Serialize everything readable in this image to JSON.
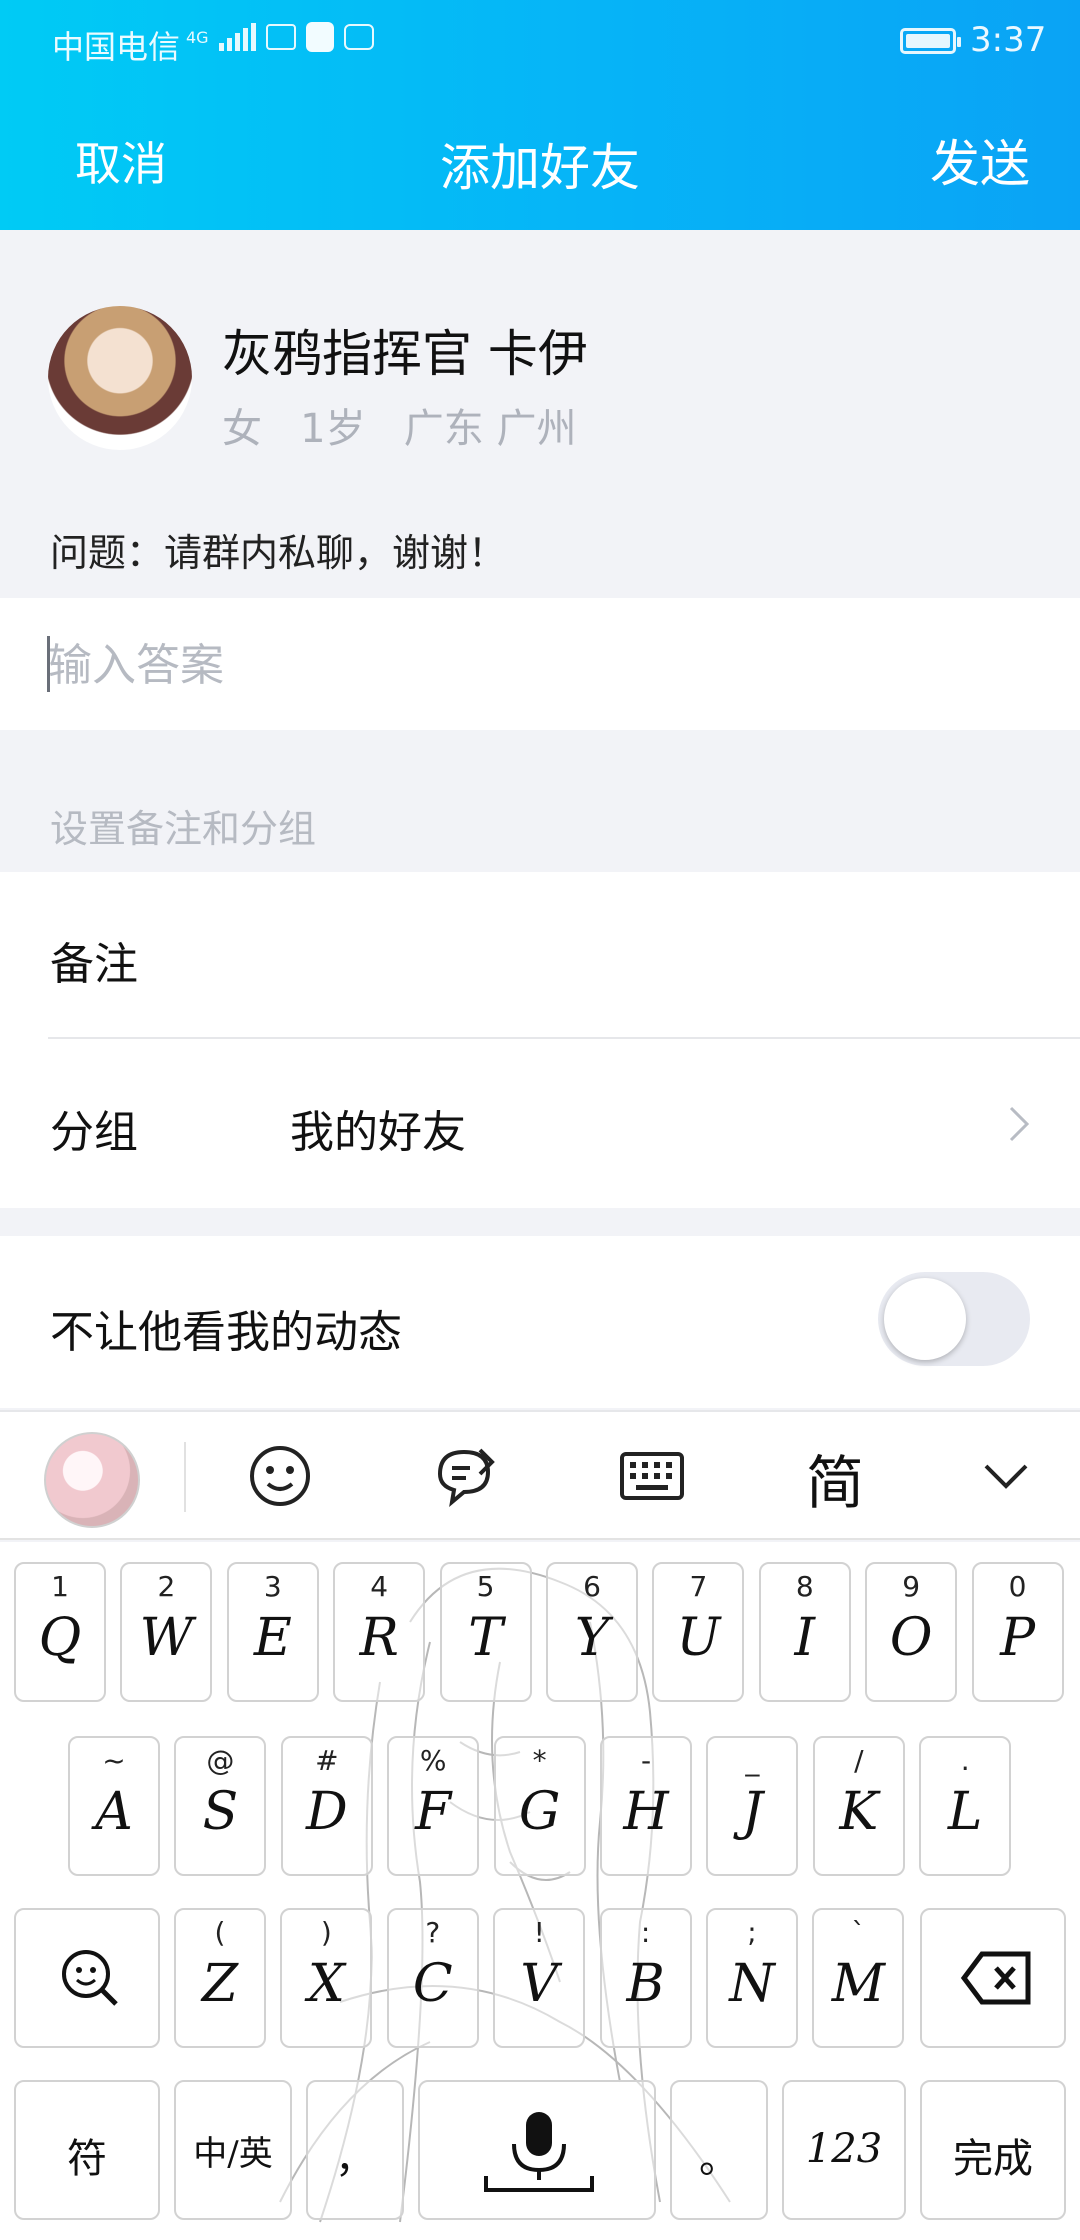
{
  "status": {
    "carrier": "中国电信",
    "network": "4G",
    "time": "3:37"
  },
  "nav": {
    "cancel": "取消",
    "title": "添加好友",
    "send": "发送"
  },
  "profile": {
    "name": "灰鸦指挥官  卡伊",
    "gender": "女",
    "age": "1岁",
    "location": "广东 广州",
    "question": "问题：请群内私聊，谢谢！"
  },
  "answer": {
    "placeholder": "输入答案",
    "value": ""
  },
  "settings": {
    "section_title": "设置备注和分组",
    "remark_label": "备注",
    "group_label": "分组",
    "group_value": "我的好友",
    "privacy_label": "不让他看我的动态",
    "privacy_enabled": false
  },
  "keyboard": {
    "toolbar": {
      "simplified": "简"
    },
    "row1": [
      {
        "sub": "1",
        "main": "Q"
      },
      {
        "sub": "2",
        "main": "W"
      },
      {
        "sub": "3",
        "main": "E"
      },
      {
        "sub": "4",
        "main": "R"
      },
      {
        "sub": "5",
        "main": "T"
      },
      {
        "sub": "6",
        "main": "Y"
      },
      {
        "sub": "7",
        "main": "U"
      },
      {
        "sub": "8",
        "main": "I"
      },
      {
        "sub": "9",
        "main": "O"
      },
      {
        "sub": "0",
        "main": "P"
      }
    ],
    "row2": [
      {
        "sub": "~",
        "main": "A"
      },
      {
        "sub": "@",
        "main": "S"
      },
      {
        "sub": "#",
        "main": "D"
      },
      {
        "sub": "%",
        "main": "F"
      },
      {
        "sub": "*",
        "main": "G"
      },
      {
        "sub": "-",
        "main": "H"
      },
      {
        "sub": "_",
        "main": "J"
      },
      {
        "sub": "/",
        "main": "K"
      },
      {
        "sub": ".",
        "main": "L"
      }
    ],
    "row3": [
      {
        "sub": "(",
        "main": "Z"
      },
      {
        "sub": ")",
        "main": "X"
      },
      {
        "sub": "?",
        "main": "C"
      },
      {
        "sub": "!",
        "main": "V"
      },
      {
        "sub": ":",
        "main": "B"
      },
      {
        "sub": ";",
        "main": "N"
      },
      {
        "sub": "`",
        "main": "M"
      }
    ],
    "row4": {
      "symbols": "符",
      "lang": "中/英",
      "comma": "，",
      "period": "。",
      "numbers": "123",
      "done": "完成"
    }
  }
}
